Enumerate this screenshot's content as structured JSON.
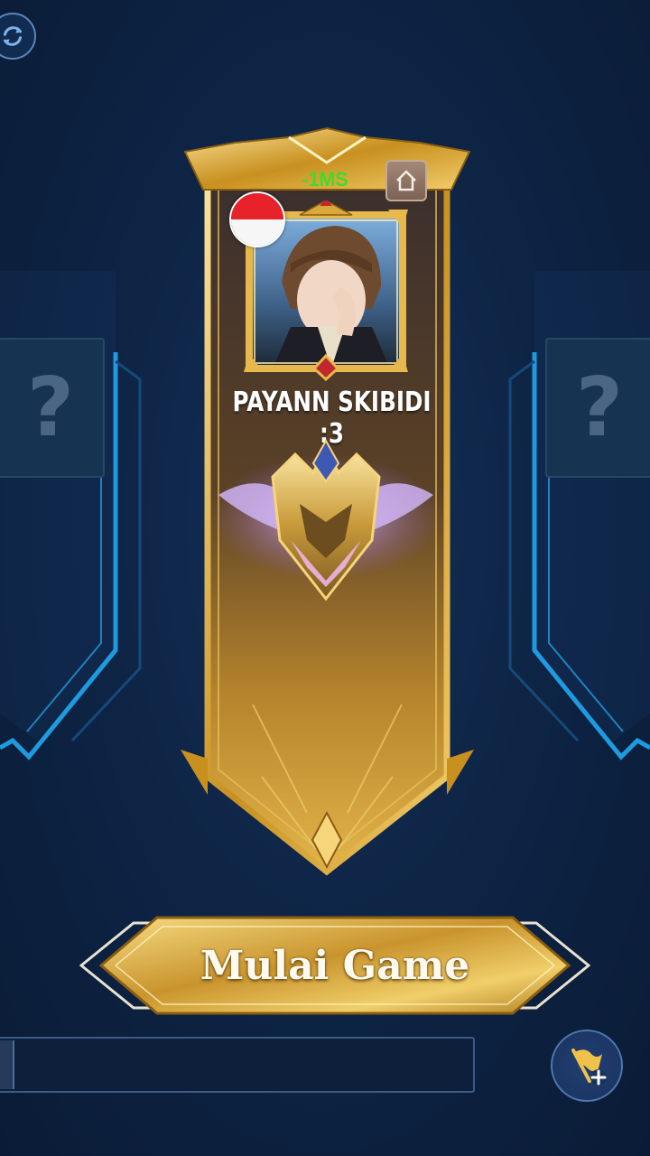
{
  "lobby": {
    "ping_text": "-1MS",
    "player_name": "PAYANN SKIBIDI :3",
    "start_button_label": "Mulai Game",
    "empty_slot_symbol": "?"
  },
  "icons": {
    "refresh": "refresh-icon",
    "home": "home-icon",
    "flag_country": "indonesia-flag-icon",
    "flag_add": "flag-add-icon"
  },
  "colors": {
    "background": "#0e2546",
    "gold": "#d9a93c",
    "ping_green": "#3fdc2a",
    "slot_blue": "#1e9be0"
  }
}
